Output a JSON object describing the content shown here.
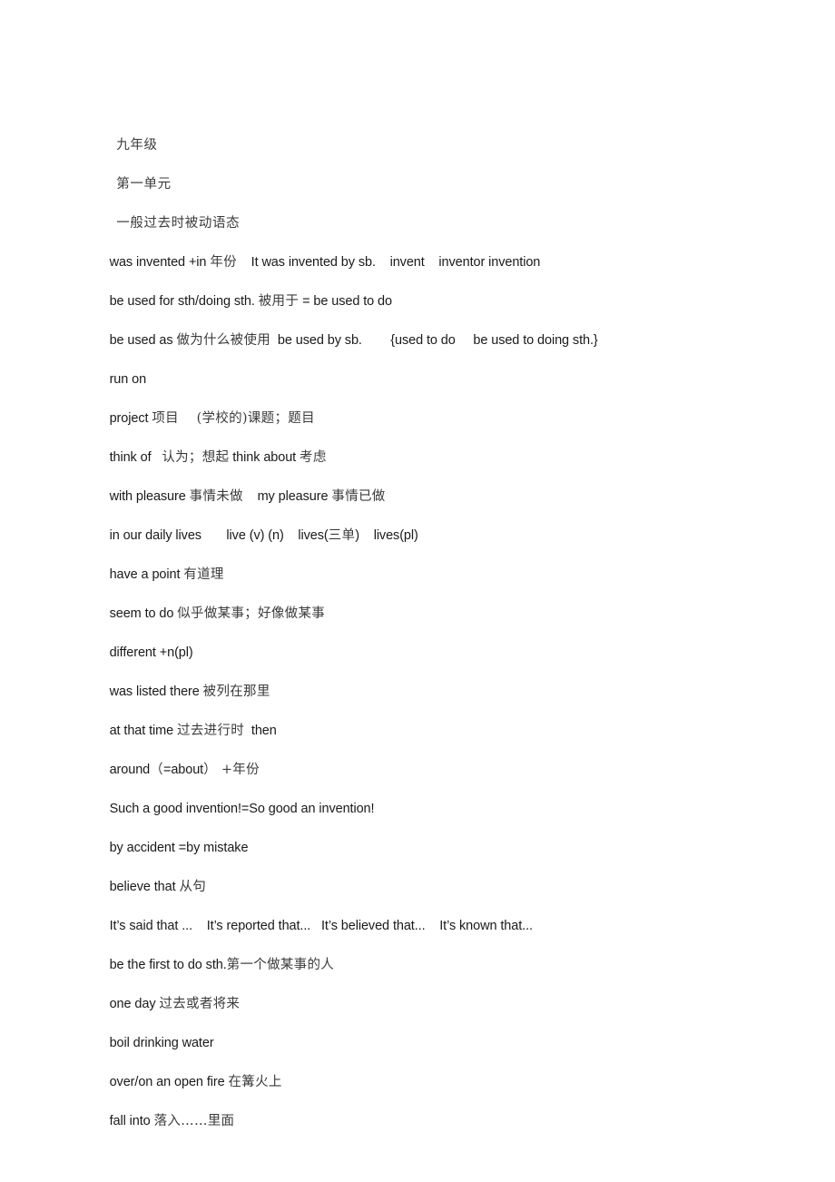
{
  "document": {
    "background_color": "#ffffff",
    "text_color": "#1a1a1a",
    "cjk_text_color": "#3b3b3b",
    "headings": [
      {
        "text": "九年级"
      },
      {
        "text": "第一单元"
      },
      {
        "text": "一般过去时被动语态"
      }
    ],
    "notes": [
      {
        "en1": "was invented +in ",
        "cjk1": "年份",
        "en2": "    It was invented by sb.    invent    inventor invention",
        "cjk2": ""
      },
      {
        "en1": "be used for sth/doing sth. ",
        "cjk1": "被用于",
        "en2": " = be used to do",
        "cjk2": ""
      },
      {
        "en1": "be used as ",
        "cjk1": "做为什么被使用",
        "en2": "  be used by sb.        {used to do     be used to doing sth.}",
        "cjk2": ""
      },
      {
        "en1": "run on",
        "cjk1": "",
        "en2": "",
        "cjk2": ""
      },
      {
        "en1": "project ",
        "cjk1": "项目    (学校的)课题；题目",
        "en2": "",
        "cjk2": ""
      },
      {
        "en1": "think of   ",
        "cjk1": "认为；想起",
        "en2": " think about ",
        "cjk2": "考虑"
      },
      {
        "en1": "with pleasure ",
        "cjk1": "事情未做",
        "en2": "    my pleasure ",
        "cjk2": "事情已做"
      },
      {
        "en1": "in our daily lives       live (v) (n)    lives(",
        "cjk1": "三单",
        "en2": ")    lives(pl)",
        "cjk2": ""
      },
      {
        "en1": "have a point ",
        "cjk1": "有道理",
        "en2": "",
        "cjk2": ""
      },
      {
        "en1": "seem to do ",
        "cjk1": "似乎做某事；好像做某事",
        "en2": "",
        "cjk2": ""
      },
      {
        "en1": "different +n(pl)",
        "cjk1": "",
        "en2": "",
        "cjk2": ""
      },
      {
        "en1": "was listed there ",
        "cjk1": "被列在那里",
        "en2": "",
        "cjk2": ""
      },
      {
        "en1": "at that time ",
        "cjk1": "过去进行时",
        "en2": "  then",
        "cjk2": ""
      },
      {
        "en1": "around",
        "cjk1": "（",
        "en2": "=about",
        "cjk2": "） +年份"
      },
      {
        "en1": "Such a good invention!=So good an invention!",
        "cjk1": "",
        "en2": "",
        "cjk2": ""
      },
      {
        "en1": "by accident =by mistake",
        "cjk1": "",
        "en2": "",
        "cjk2": ""
      },
      {
        "en1": "believe that ",
        "cjk1": "从句",
        "en2": "",
        "cjk2": ""
      },
      {
        "en1": "It’s said that ...    It’s reported that...   It’s believed that...    It’s known that...",
        "cjk1": "",
        "en2": "",
        "cjk2": ""
      },
      {
        "en1": "be the first to do sth.",
        "cjk1": "第一个做某事的人",
        "en2": "",
        "cjk2": ""
      },
      {
        "en1": "one day ",
        "cjk1": "过去或者将来",
        "en2": "",
        "cjk2": ""
      },
      {
        "en1": "boil drinking water",
        "cjk1": "",
        "en2": "",
        "cjk2": ""
      },
      {
        "en1": "over/on an open fire ",
        "cjk1": "在篝火上",
        "en2": "",
        "cjk2": ""
      },
      {
        "en1": "fall into ",
        "cjk1": "落入……里面",
        "en2": "",
        "cjk2": ""
      }
    ]
  }
}
